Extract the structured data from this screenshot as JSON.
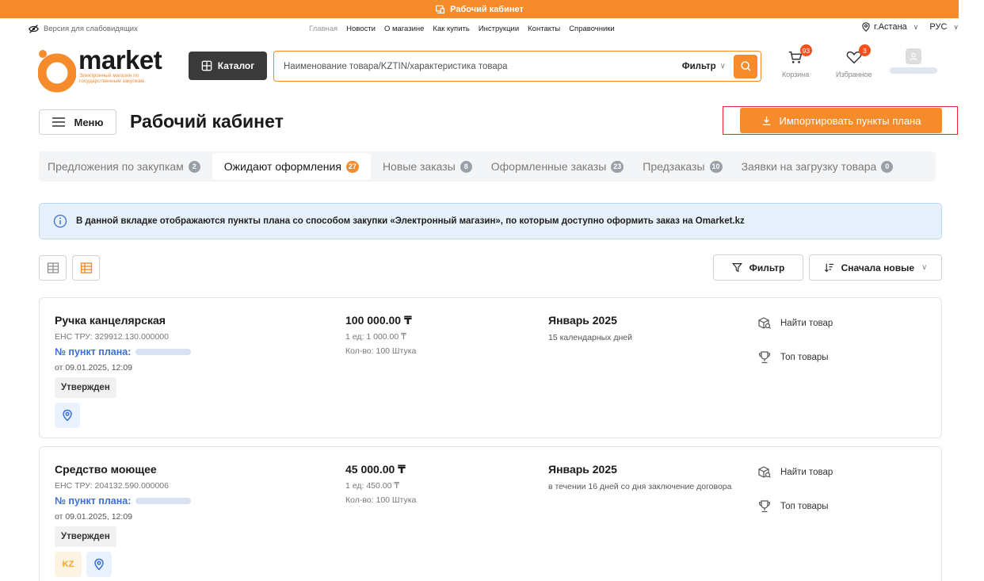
{
  "banner": {
    "label": "Рабочий кабинет"
  },
  "util": {
    "accessibility": "Версия для слабовидящих",
    "nav": [
      "Главная",
      "Новости",
      "О магазине",
      "Как купить",
      "Инструкции",
      "Контакты",
      "Справочники"
    ],
    "city": "г.Астана",
    "lang": "РУС"
  },
  "header": {
    "logo_text": "market",
    "logo_sub": "Электронный магазин по государственным закупкам",
    "catalog_label": "Каталог",
    "search_placeholder": "Наименование товара/KZTIN/характеристика товара",
    "filter_label": "Фильтр",
    "cart_label": "Корзина",
    "cart_count": "93",
    "fav_label": "Избранное",
    "fav_count": "3"
  },
  "page": {
    "menu_label": "Меню",
    "title": "Рабочий кабинет",
    "import_label": "Импортировать пункты плана"
  },
  "tabs": [
    {
      "label": "Предложения по закупкам",
      "count": "2"
    },
    {
      "label": "Ожидают оформления",
      "count": "27"
    },
    {
      "label": "Новые заказы",
      "count": "8"
    },
    {
      "label": "Оформленные заказы",
      "count": "23"
    },
    {
      "label": "Предзаказы",
      "count": "10"
    },
    {
      "label": "Заявки на загрузку товара",
      "count": "0"
    }
  ],
  "info_text": "В данной вкладке отображаются пункты плана со способом закупки «Электронный магазин», по которым доступно оформить заказ на Omarket.kz",
  "controls": {
    "filter_label": "Фильтр",
    "sort_label": "Сначала новые"
  },
  "cards": [
    {
      "name": "Ручка канцелярская",
      "ens": "ЕНС ТРУ: 329912.130.000000",
      "plan_label": "№ пункт плана:",
      "date": "от 09.01.2025, 12:09",
      "status": "Утвержден",
      "price": "100 000.00 ₸",
      "unit_price": "1 ед: 1 000.00 ₸",
      "qty": "Кол-во: 100 Штука",
      "month": "Январь 2025",
      "term": "15 календарных дней",
      "find_label": "Найти товар",
      "top_label": "Топ товары"
    },
    {
      "name": "Средство моющее",
      "ens": "ЕНС ТРУ: 204132.590.000006",
      "plan_label": "№ пункт плана:",
      "date": "от 09.01.2025, 12:09",
      "status": "Утвержден",
      "kz_badge": "KZ",
      "price": "45 000.00 ₸",
      "unit_price": "1 ед: 450.00 ₸",
      "qty": "Кол-во: 100 Штука",
      "month": "Январь 2025",
      "term": "в течении 16 дней со дня заключение договора",
      "find_label": "Найти товар",
      "top_label": "Топ товары"
    }
  ],
  "colors": {
    "accent": "#f58b2a",
    "link": "#3b6fd6",
    "info_bg": "#e7f1fb",
    "highlight": "#e52727"
  }
}
